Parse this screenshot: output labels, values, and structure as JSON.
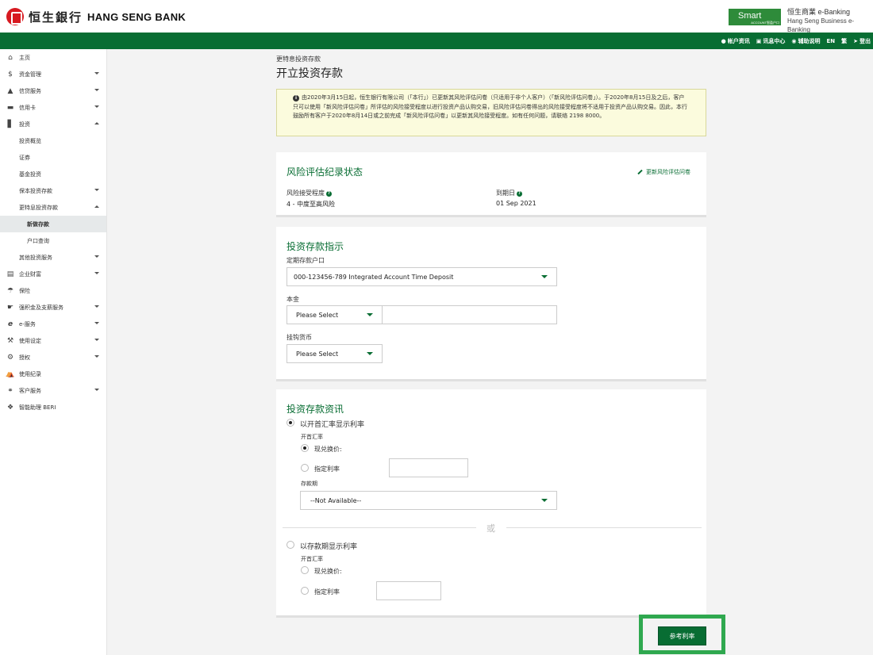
{
  "header": {
    "logo_cn": "恒生銀行",
    "logo_en": "HANG SENG BANK",
    "smart_label": "Smart",
    "smart_small": "ACCOUNT智盈户口",
    "brand_cn": "恒生商業 e-Banking",
    "brand_en": "Hang Seng Business e-Banking",
    "topnav": {
      "account_info": "帐户资讯",
      "message_center": "讯息中心",
      "help": "辅助说明",
      "lang_en": "EN",
      "lang_tc": "繁",
      "logout": "登出"
    }
  },
  "sidebar": {
    "items": [
      {
        "label": "主页",
        "icon": "home-icon"
      },
      {
        "label": "资金管理",
        "icon": "dollar-icon"
      },
      {
        "label": "信贷服务",
        "icon": "money-bag-icon"
      },
      {
        "label": "信用卡",
        "icon": "credit-card-icon"
      },
      {
        "label": "投资",
        "icon": "bar-chart-icon"
      },
      {
        "label": "投资概览"
      },
      {
        "label": "证券"
      },
      {
        "label": "基金投资"
      },
      {
        "label": "保本投资存款"
      },
      {
        "label": "更特息投资存款"
      },
      {
        "label": "新做存款"
      },
      {
        "label": "户口查询"
      },
      {
        "label": "其他投资服务"
      },
      {
        "label": "企业财富",
        "icon": "chart-bars-icon"
      },
      {
        "label": "保险",
        "icon": "umbrella-icon"
      },
      {
        "label": "强积金及支薪服务",
        "icon": "hand-coin-icon"
      },
      {
        "label": "e-服务",
        "icon": "e-icon"
      },
      {
        "label": "使用设定",
        "icon": "wrench-icon"
      },
      {
        "label": "授权",
        "icon": "gavel-icon"
      },
      {
        "label": "使用纪录",
        "icon": "bank-icon"
      },
      {
        "label": "客户服务",
        "icon": "headset-icon"
      },
      {
        "label": "智能助理 BERI",
        "icon": "beri-icon"
      }
    ]
  },
  "main": {
    "breadcrumb": "更特息投资存款",
    "title": "开立投资存款",
    "notice": "由2020年3月15日起，恒生银行有限公司（「本行」）已更新其风险评估问卷（只适用于非个人客户）（「新风险评估问卷」）。于2020年8月15日及之后，客户只可以使用「新风险评估问卷」所评估的风险接受程度以进行投资产品认购交易，旧风险评估问卷得出的风险接受程度将不适用于投资产品认购交易。因此，本行鼓励所有客户于2020年8月14日或之前完成「新风险评估问卷」以更新其风险接受程度。如有任何问题，请联络 2198 8000。",
    "risk": {
      "title": "风险评估纪录状态",
      "update_link": "更新风险评估问卷",
      "tolerance_label": "风险接受程度",
      "tolerance_value": "4 - 中度至高风险",
      "expiry_label": "到期日",
      "expiry_value": "01 Sep 2021"
    },
    "instruction": {
      "title": "投资存款指示",
      "account_label": "定期存款户口",
      "account_value": "000-123456-789 Integrated Account Time Deposit",
      "principal_label": "本金",
      "principal_currency": "Please Select",
      "principal_amount": "",
      "linked_label": "挂钩货币",
      "linked_currency": "Please Select"
    },
    "info": {
      "title": "投资存款资讯",
      "opt1_label": "以开首汇率显示利率",
      "opt1_rate_label": "开首汇率",
      "opt1_spot": "现兑换价:",
      "opt1_fixed": "指定利率",
      "tenor_label": "存款期",
      "tenor_value": "--Not Available--",
      "or_text": "或",
      "opt2_label": "以存款期显示利率",
      "opt2_rate_label": "开首汇率",
      "opt2_spot": "现兑换价:",
      "opt2_fixed": "指定利率"
    },
    "ref_button": "参考利率"
  },
  "colors": {
    "brand_green": "#086d33",
    "highlight": "#2fa84f",
    "notice_bg": "#fbfbdd"
  }
}
